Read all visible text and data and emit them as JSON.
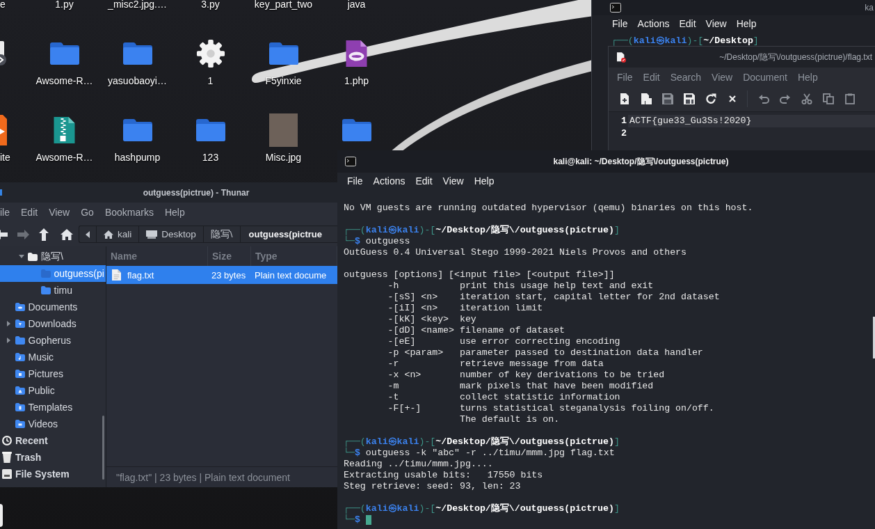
{
  "desktop": {
    "icon_rows": [
      [
        {
          "label": "e"
        },
        {
          "label": "1.py"
        },
        {
          "label": "_misc2.jpg.…"
        },
        {
          "label": "3.py"
        },
        {
          "label": "key_part_two"
        },
        {
          "label": "java"
        }
      ],
      [
        {
          "kind": "link"
        },
        {
          "label": "Awsome-R…",
          "kind": "folder"
        },
        {
          "label": "yasuobaoyi…",
          "kind": "folder"
        },
        {
          "label": "1",
          "kind": "executable"
        },
        {
          "label": "F5yinxie",
          "kind": "folder"
        },
        {
          "label": "1.php",
          "kind": "php"
        }
      ],
      [
        {
          "label": "ite",
          "kind": "application"
        },
        {
          "label": "Awsome-R…",
          "kind": "archive"
        },
        {
          "label": "hashpump",
          "kind": "folder"
        },
        {
          "label": "123",
          "kind": "folder"
        },
        {
          "label": "Misc.jpg",
          "kind": "image"
        },
        {
          "kind": "folder"
        }
      ]
    ]
  },
  "back_terminal": {
    "title": "ka",
    "menu": [
      "File",
      "Actions",
      "Edit",
      "View",
      "Help"
    ],
    "lines": [
      {
        "kind": "prompt",
        "corner": "┌──(",
        "user": "kali㉿kali",
        "bracket_open": ")-[",
        "path": "~/Desktop",
        "bracket_close": "]"
      }
    ]
  },
  "text_editor": {
    "title": "~/Desktop/隐写\\/outguess(pictrue)/flag.txt",
    "menu": [
      "File",
      "Edit",
      "Search",
      "View",
      "Document",
      "Help"
    ],
    "toolbar": [
      {
        "kind": "new",
        "disabled": false
      },
      {
        "kind": "new-window",
        "disabled": false
      },
      {
        "kind": "save",
        "disabled": true
      },
      {
        "kind": "save-as",
        "disabled": false
      },
      {
        "kind": "reload",
        "disabled": false
      },
      {
        "kind": "close",
        "disabled": false
      },
      {
        "kind": "separator"
      },
      {
        "kind": "undo",
        "disabled": true
      },
      {
        "kind": "redo",
        "disabled": true
      },
      {
        "kind": "cut",
        "disabled": true
      },
      {
        "kind": "copy",
        "disabled": true
      },
      {
        "kind": "paste",
        "disabled": true
      }
    ],
    "lines": [
      {
        "number": "1",
        "text": "ACTF{gue33_Gu3Ss!2020}",
        "current": true
      },
      {
        "number": "2",
        "current": false
      }
    ]
  },
  "file_manager": {
    "title": "outguess(pictrue) - Thunar",
    "menu": [
      "ile",
      "Edit",
      "View",
      "Go",
      "Bookmarks",
      "Help"
    ],
    "toolbar": [
      {
        "kind": "back",
        "disabled": false
      },
      {
        "kind": "forward",
        "disabled": true
      },
      {
        "kind": "up",
        "disabled": false
      },
      {
        "kind": "home",
        "disabled": false
      }
    ],
    "path": [
      {
        "label": "kali",
        "kind": "home",
        "selected": false
      },
      {
        "label": "Desktop",
        "kind": "desktop",
        "selected": false
      },
      {
        "label": "隐写\\",
        "kind": "folder",
        "selected": false
      },
      {
        "label": "outguess(pictrue",
        "kind": "folder",
        "selected": true
      }
    ],
    "sidebar": [
      {
        "children": [
          {
            "children": [
              {
                "label": "隐写\\",
                "kind": "open-folder",
                "expanded": true,
                "selected": false,
                "children": [
                  {
                    "label": "outguess(pi",
                    "kind": "folder",
                    "selected": true
                  },
                  {
                    "label": "timu",
                    "kind": "folder",
                    "selected": false
                  }
                ]
              }
            ]
          },
          {
            "label": "Documents",
            "kind": "documents",
            "selected": false
          },
          {
            "label": "Downloads",
            "kind": "downloads",
            "expanded": false,
            "selected": false
          },
          {
            "label": "Gopherus",
            "kind": "folder",
            "expanded": false,
            "selected": false
          },
          {
            "label": "Music",
            "kind": "music",
            "selected": false
          },
          {
            "label": "Pictures",
            "kind": "pictures",
            "selected": false
          },
          {
            "label": "Public",
            "kind": "public",
            "selected": false
          },
          {
            "label": "Templates",
            "kind": "templates",
            "selected": false
          },
          {
            "label": "Videos",
            "kind": "videos",
            "selected": false
          }
        ]
      },
      {
        "label": "Recent",
        "kind": "recent",
        "selected": false
      },
      {
        "label": "Trash",
        "kind": "trash",
        "selected": false
      },
      {
        "label": "File System",
        "kind": "filesystem",
        "selected": false
      }
    ],
    "columns": [
      "Name",
      "Size",
      "Type"
    ],
    "rows": [
      {
        "cells": [
          "flag.txt",
          "23 bytes",
          "Plain text docume"
        ],
        "selected": true
      }
    ],
    "status": "\"flag.txt\" | 23 bytes | Plain text document"
  },
  "terminal": {
    "title": "kali@kali: ~/Desktop/隐写\\/outguess(pictrue)",
    "menu": [
      "File",
      "Actions",
      "Edit",
      "View",
      "Help"
    ],
    "lines": [
      {
        "kind": "output",
        "text": "No VM guests are running outdated hypervisor (qemu) binaries on this host."
      },
      {
        "kind": "blank"
      },
      {
        "kind": "prompt",
        "corner": "┌──(",
        "user": "kali㉿kali",
        "bracket_open": ")-[",
        "path": "~/Desktop/隐写\\/outguess(pictrue)",
        "bracket_close": "]"
      },
      {
        "kind": "command",
        "corner": "└─",
        "sigil": "$",
        "command": "outguess"
      },
      {
        "kind": "output",
        "text": "OutGuess 0.4 Universal Stego 1999-2021 Niels Provos and others"
      },
      {
        "kind": "blank"
      },
      {
        "kind": "output",
        "text": "outguess [options] [<input file> [<output file>]]"
      },
      {
        "kind": "option",
        "option": "-h",
        "description": "print this usage help text and exit"
      },
      {
        "kind": "option",
        "option": "-[sS] <n>",
        "description": "iteration start, capital letter for 2nd dataset"
      },
      {
        "kind": "option",
        "option": "-[iI] <n>",
        "description": "iteration limit"
      },
      {
        "kind": "option",
        "option": "-[kK] <key>",
        "description": "key"
      },
      {
        "kind": "option",
        "option": "-[dD] <name>",
        "description": "filename of dataset"
      },
      {
        "kind": "option",
        "option": "-[eE]",
        "description": "use error correcting encoding"
      },
      {
        "kind": "option",
        "option": "-p <param>",
        "description": "parameter passed to destination data handler"
      },
      {
        "kind": "option",
        "option": "-r",
        "description": "retrieve message from data"
      },
      {
        "kind": "option",
        "option": "-x <n>",
        "description": "number of key derivations to be tried"
      },
      {
        "kind": "option",
        "option": "-m",
        "description": "mark pixels that have been modified"
      },
      {
        "kind": "option",
        "option": "-t",
        "description": "collect statistic information"
      },
      {
        "kind": "option",
        "option": "-F[+-]",
        "description": "turns statistical steganalysis foiling on/off."
      },
      {
        "kind": "option",
        "description": "The default is on."
      },
      {
        "kind": "blank"
      },
      {
        "kind": "prompt",
        "corner": "┌──(",
        "user": "kali㉿kali",
        "bracket_open": ")-[",
        "path": "~/Desktop/隐写\\/outguess(pictrue)",
        "bracket_close": "]"
      },
      {
        "kind": "command",
        "corner": "└─",
        "sigil": "$",
        "command": "outguess -k \"abc\" -r ../timu/mmm.jpg flag.txt"
      },
      {
        "kind": "output",
        "text": "Reading ../timu/mmm.jpg...."
      },
      {
        "kind": "output",
        "text": "Extracting usable bits:   17550 bits"
      },
      {
        "kind": "output",
        "text": "Steg retrieve: seed: 93, len: 23"
      },
      {
        "kind": "blank"
      },
      {
        "kind": "prompt",
        "corner": "┌──(",
        "user": "kali㉿kali",
        "bracket_open": ")-[",
        "path": "~/Desktop/隐写\\/outguess(pictrue)",
        "bracket_close": "]"
      },
      {
        "kind": "command",
        "corner": "└─",
        "sigil": "$",
        "cursor": true
      }
    ]
  }
}
